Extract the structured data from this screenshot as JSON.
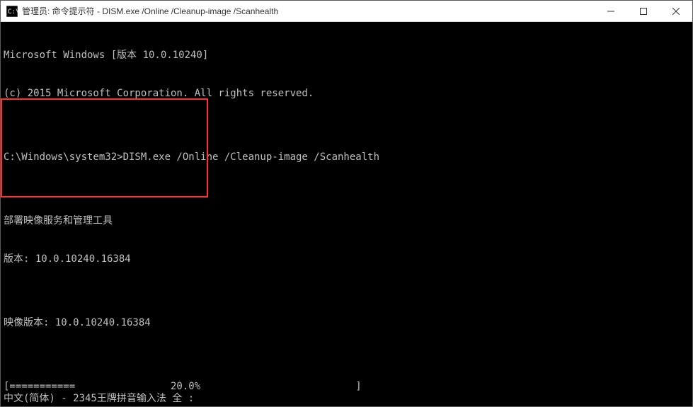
{
  "titlebar": {
    "text": "管理员: 命令提示符 - DISM.exe  /Online /Cleanup-image /Scanhealth"
  },
  "terminal": {
    "line1": "Microsoft Windows [版本 10.0.10240]",
    "line2": "(c) 2015 Microsoft Corporation. All rights reserved.",
    "line3": "",
    "line4": "C:\\Windows\\system32>DISM.exe /Online /Cleanup-image /Scanhealth",
    "line5": "",
    "line6": "部署映像服务和管理工具",
    "line7": "版本: 10.0.10240.16384",
    "line8": "",
    "line9": "映像版本: 10.0.10240.16384",
    "line10": "",
    "line11": "[===========                20.0%                          ]"
  },
  "ime": {
    "text": "中文(简体) - 2345王牌拼音输入法 全 :"
  }
}
